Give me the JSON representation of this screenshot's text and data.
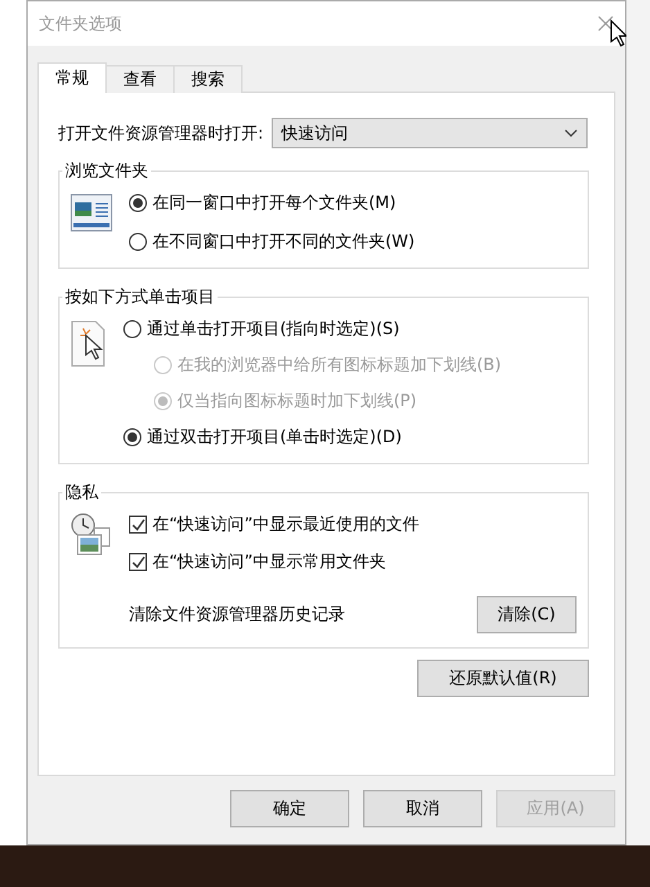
{
  "window": {
    "title": "文件夹选项"
  },
  "tabs": [
    {
      "label": "常规",
      "selected": true
    },
    {
      "label": "查看",
      "selected": false
    },
    {
      "label": "搜索",
      "selected": false
    }
  ],
  "open_in": {
    "label": "打开文件资源管理器时打开:",
    "value": "快速访问"
  },
  "browse_folders": {
    "title": "浏览文件夹",
    "options": [
      {
        "label": "在同一窗口中打开每个文件夹(M)",
        "selected": true,
        "disabled": false
      },
      {
        "label": "在不同窗口中打开不同的文件夹(W)",
        "selected": false,
        "disabled": false
      }
    ]
  },
  "click_items": {
    "title": "按如下方式单击项目",
    "options": [
      {
        "label": "通过单击打开项目(指向时选定)(S)",
        "selected": false,
        "disabled": false,
        "children": [
          {
            "label": "在我的浏览器中给所有图标标题加下划线(B)",
            "selected": false,
            "disabled": true
          },
          {
            "label": "仅当指向图标标题时加下划线(P)",
            "selected": true,
            "disabled": true
          }
        ]
      },
      {
        "label": "通过双击打开项目(单击时选定)(D)",
        "selected": true,
        "disabled": false
      }
    ]
  },
  "privacy": {
    "title": "隐私",
    "checkboxes": [
      {
        "label": "在“快速访问”中显示最近使用的文件",
        "checked": true
      },
      {
        "label": "在“快速访问”中显示常用文件夹",
        "checked": true
      }
    ],
    "clear_label": "清除文件资源管理器历史记录",
    "clear_button": "清除(C)"
  },
  "restore_button": "还原默认值(R)",
  "buttons": [
    {
      "label": "确定",
      "disabled": false
    },
    {
      "label": "取消",
      "disabled": false
    },
    {
      "label": "应用(A)",
      "disabled": true
    }
  ]
}
